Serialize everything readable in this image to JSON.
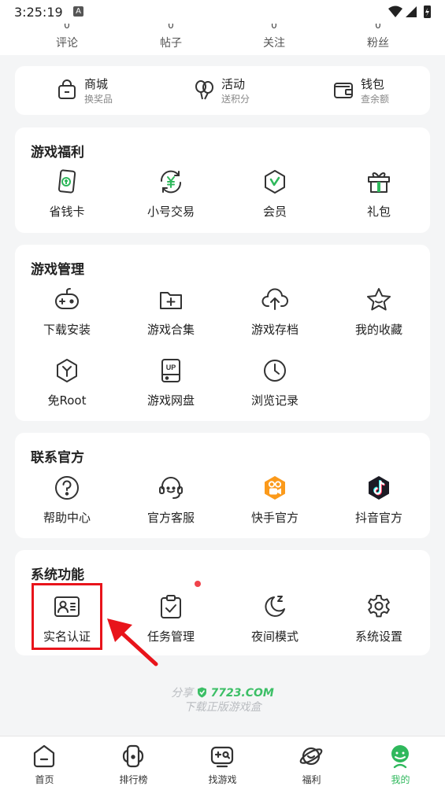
{
  "status_bar": {
    "time": "3:25:19",
    "notification_letter": "A"
  },
  "stats": [
    {
      "label": "评论",
      "value": "0"
    },
    {
      "label": "帖子",
      "value": "0"
    },
    {
      "label": "关注",
      "value": "0"
    },
    {
      "label": "粉丝",
      "value": "0"
    }
  ],
  "quick_links": [
    {
      "title": "商城",
      "subtitle": "换奖品",
      "icon": "shopping-bag-icon"
    },
    {
      "title": "活动",
      "subtitle": "送积分",
      "icon": "balloons-icon"
    },
    {
      "title": "钱包",
      "subtitle": "查余额",
      "icon": "wallet-icon"
    }
  ],
  "game_benefits": {
    "title": "游戏福利",
    "items": [
      {
        "label": "省钱卡",
        "icon": "money-card-icon"
      },
      {
        "label": "小号交易",
        "icon": "yuan-exchange-icon"
      },
      {
        "label": "会员",
        "icon": "vip-shield-icon"
      },
      {
        "label": "礼包",
        "icon": "gift-icon"
      }
    ]
  },
  "game_management": {
    "title": "游戏管理",
    "items": [
      {
        "label": "下载安装",
        "icon": "gamepad-icon"
      },
      {
        "label": "游戏合集",
        "icon": "folder-plus-icon"
      },
      {
        "label": "游戏存档",
        "icon": "cloud-upload-icon"
      },
      {
        "label": "我的收藏",
        "icon": "star-icon"
      },
      {
        "label": "免Root",
        "icon": "hexagon-y-icon"
      },
      {
        "label": "游戏网盘",
        "icon": "cloud-drive-icon"
      },
      {
        "label": "浏览记录",
        "icon": "clock-icon"
      }
    ],
    "drive_badge": "UP"
  },
  "contact": {
    "title": "联系官方",
    "items": [
      {
        "label": "帮助中心",
        "icon": "question-icon"
      },
      {
        "label": "官方客服",
        "icon": "headset-icon"
      },
      {
        "label": "快手官方",
        "icon": "kuaishou-icon"
      },
      {
        "label": "抖音官方",
        "icon": "douyin-icon"
      }
    ]
  },
  "system": {
    "title": "系统功能",
    "items": [
      {
        "label": "实名认证",
        "icon": "id-card-icon"
      },
      {
        "label": "任务管理",
        "icon": "clipboard-check-icon"
      },
      {
        "label": "夜间模式",
        "icon": "moon-icon"
      },
      {
        "label": "系统设置",
        "icon": "gear-icon"
      }
    ]
  },
  "footer": {
    "share_label": "分享",
    "brand": "7723.COM",
    "tagline": "下载正版游戏盒"
  },
  "bottom_nav": [
    {
      "label": "首页",
      "icon": "home-icon",
      "active": false
    },
    {
      "label": "排行榜",
      "icon": "ranking-icon",
      "active": false
    },
    {
      "label": "找游戏",
      "icon": "find-game-icon",
      "active": false
    },
    {
      "label": "福利",
      "icon": "planet-icon",
      "active": false
    },
    {
      "label": "我的",
      "icon": "profile-icon",
      "active": true
    }
  ],
  "colors": {
    "accent": "#2fb85c",
    "highlight": "#e8141b",
    "badge_dot": "#f0434b",
    "icon_stroke": "#333333"
  }
}
